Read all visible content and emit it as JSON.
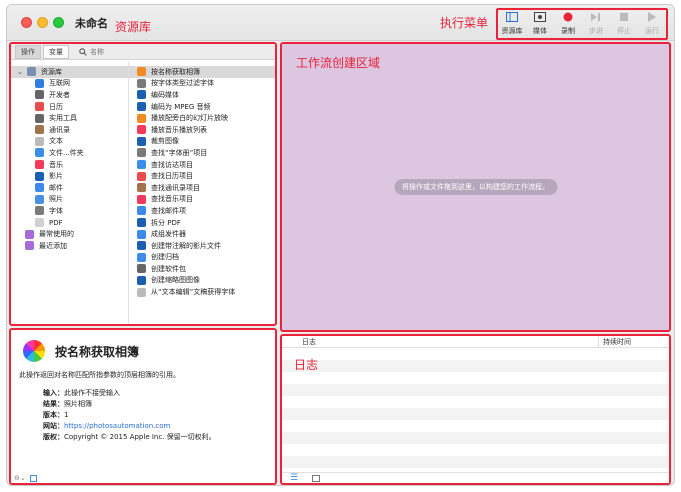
{
  "window": {
    "title": "未命名"
  },
  "annotations": {
    "library": "资源库",
    "toolbar": "执行菜单",
    "workflow": "工作流创建区域",
    "log": "日志"
  },
  "toolbar": {
    "items": [
      {
        "label": "资源库",
        "icon": "sidebar-icon",
        "enabled": true
      },
      {
        "label": "媒体",
        "icon": "media-icon",
        "enabled": true
      },
      {
        "label": "录制",
        "icon": "record-icon",
        "enabled": true
      },
      {
        "label": "步进",
        "icon": "step-icon",
        "enabled": false
      },
      {
        "label": "停止",
        "icon": "stop-icon",
        "enabled": false
      },
      {
        "label": "运行",
        "icon": "play-icon",
        "enabled": false
      }
    ]
  },
  "library": {
    "segments": [
      "操作",
      "变量"
    ],
    "search_placeholder": "名称",
    "root": "资源库",
    "categories": [
      {
        "label": "互联网",
        "color": "#2f7fe0"
      },
      {
        "label": "开发者",
        "color": "#666666"
      },
      {
        "label": "日历",
        "color": "#e84c4c"
      },
      {
        "label": "实用工具",
        "color": "#666666"
      },
      {
        "label": "通讯录",
        "color": "#a0734a"
      },
      {
        "label": "文本",
        "color": "#bbbbbb"
      },
      {
        "label": "文件...件夹",
        "color": "#3c8ee8"
      },
      {
        "label": "音乐",
        "color": "#f23b5c"
      },
      {
        "label": "影片",
        "color": "#1b5fb0"
      },
      {
        "label": "邮件",
        "color": "#3a8ce8"
      },
      {
        "label": "照片",
        "color": "#4a90e2"
      },
      {
        "label": "字体",
        "color": "#7a7a7a"
      },
      {
        "label": "PDF",
        "color": "#d0d0d0"
      }
    ],
    "groups": [
      {
        "label": "最常使用的",
        "color": "#a66ad9"
      },
      {
        "label": "最近添加",
        "color": "#a66ad9"
      }
    ],
    "actions": [
      {
        "label": "按名称获取相簿",
        "color": "#f08a24"
      },
      {
        "label": "按字体类型过滤字体",
        "color": "#7a7a7a"
      },
      {
        "label": "编码媒体",
        "color": "#1b5fb0"
      },
      {
        "label": "编码为 MPEG 音频",
        "color": "#1b5fb0"
      },
      {
        "label": "播放配旁白的幻灯片放映",
        "color": "#f08a24"
      },
      {
        "label": "播放音乐播放列表",
        "color": "#f23b5c"
      },
      {
        "label": "裁剪图像",
        "color": "#1b5fb0"
      },
      {
        "label": "查找“字体册”项目",
        "color": "#7a7a7a"
      },
      {
        "label": "查找访达项目",
        "color": "#3c8ee8"
      },
      {
        "label": "查找日历项目",
        "color": "#e84c4c"
      },
      {
        "label": "查找通讯录项目",
        "color": "#a0734a"
      },
      {
        "label": "查找音乐项目",
        "color": "#f23b5c"
      },
      {
        "label": "查找邮件项",
        "color": "#3a8ce8"
      },
      {
        "label": "拆分 PDF",
        "color": "#1b5fb0"
      },
      {
        "label": "成组发件器",
        "color": "#3a8ce8"
      },
      {
        "label": "创建带注解的影片文件",
        "color": "#1b5fb0"
      },
      {
        "label": "创建归档",
        "color": "#3c8ee8"
      },
      {
        "label": "创建软件包",
        "color": "#666666"
      },
      {
        "label": "创建缩略图图像",
        "color": "#1b5fb0"
      },
      {
        "label": "从“文本编辑”文稿获得字体",
        "color": "#bbbbbb"
      }
    ]
  },
  "description": {
    "title": "按名称获取相簿",
    "summary": "此操作返回对名称匹配所指参数的顶层相簿的引用。",
    "fields": [
      {
        "key": "输入：",
        "value": "此操作不接受输入"
      },
      {
        "key": "结果：",
        "value": "照片相簿"
      },
      {
        "key": "版本：",
        "value": "1"
      },
      {
        "key": "网站：",
        "value": "https://photosautomation.com"
      },
      {
        "key": "版权：",
        "value": "Copyright © 2015 Apple Inc. 保留一切权利。"
      }
    ]
  },
  "workflow": {
    "hint": "将操作或文件拖到这里，以构建您的工作流程。"
  },
  "log": {
    "col_log": "日志",
    "col_duration": "持续时间"
  }
}
